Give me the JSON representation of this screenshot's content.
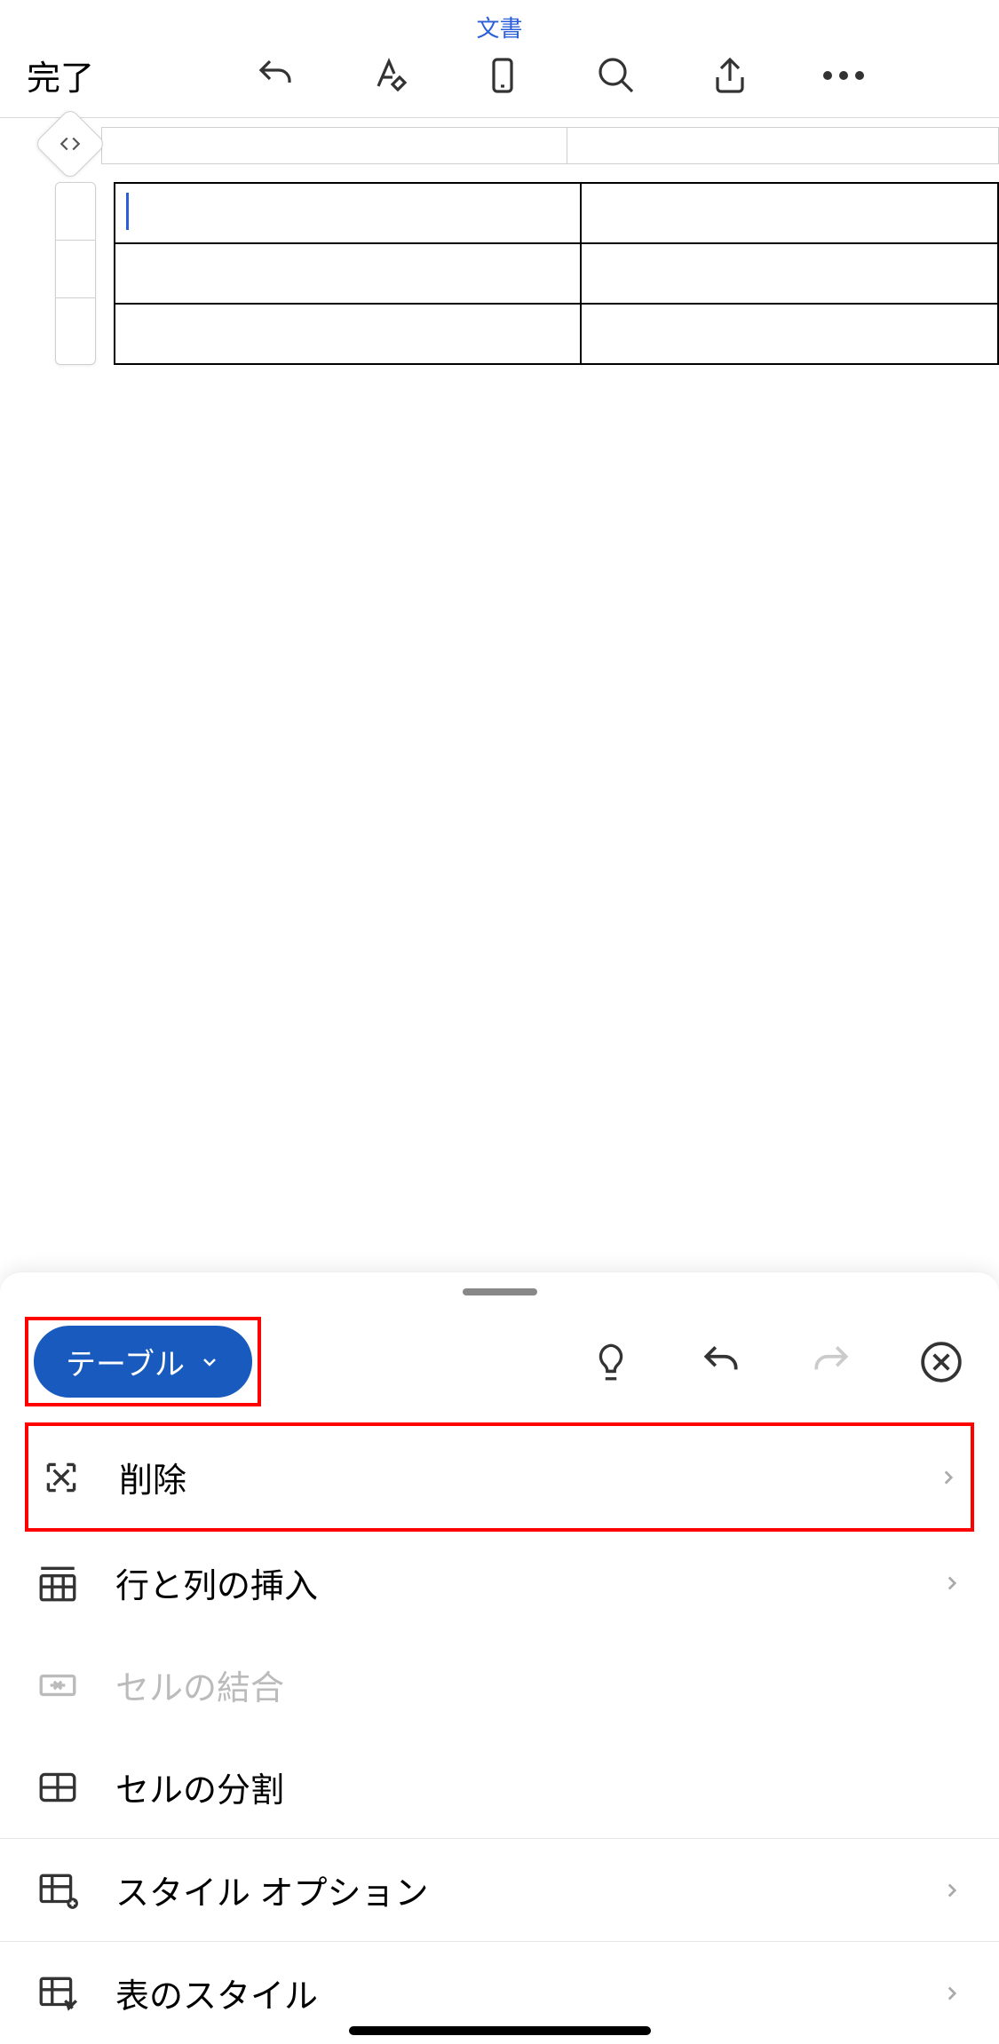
{
  "header": {
    "doc_title": "文書",
    "done_label": "完了"
  },
  "panel": {
    "chip_label": "テーブル",
    "items": [
      {
        "label": "削除",
        "icon": "delete-table-icon",
        "disclosure": true,
        "disabled": false,
        "highlighted": true
      },
      {
        "label": "行と列の挿入",
        "icon": "insert-rows-cols-icon",
        "disclosure": true,
        "disabled": false
      },
      {
        "label": "セルの結合",
        "icon": "merge-cells-icon",
        "disclosure": false,
        "disabled": true
      },
      {
        "label": "セルの分割",
        "icon": "split-cells-icon",
        "disclosure": false,
        "disabled": false
      },
      {
        "label": "スタイル オプション",
        "icon": "style-options-icon",
        "disclosure": true,
        "disabled": false,
        "border": true
      },
      {
        "label": "表のスタイル",
        "icon": "table-styles-icon",
        "disclosure": true,
        "disabled": false,
        "border": true
      }
    ]
  }
}
